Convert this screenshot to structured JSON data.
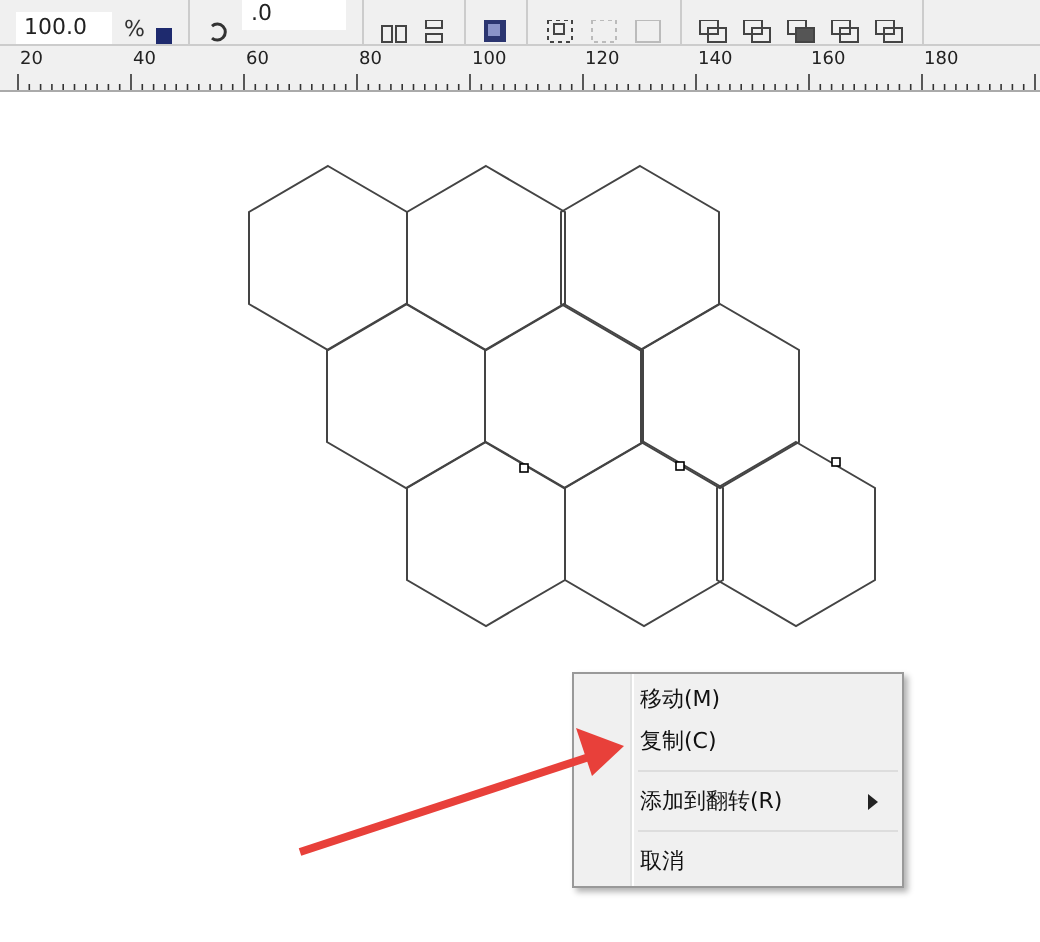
{
  "toolbar": {
    "scale_field": {
      "value": "100.0",
      "unit": "%"
    },
    "rotation_field": {
      "value": ".0"
    }
  },
  "ruler": {
    "labels": [
      "20",
      "40",
      "60",
      "80",
      "100",
      "120",
      "140",
      "160",
      "180"
    ]
  },
  "context_menu": {
    "items": [
      {
        "kind": "item",
        "label": "移动(M)",
        "submenu": false
      },
      {
        "kind": "item",
        "label": "复制(C)",
        "submenu": false
      },
      {
        "kind": "separator"
      },
      {
        "kind": "item",
        "label": "添加到翻转(R)",
        "submenu": true
      },
      {
        "kind": "separator"
      },
      {
        "kind": "item",
        "label": "取消",
        "submenu": false
      }
    ]
  }
}
